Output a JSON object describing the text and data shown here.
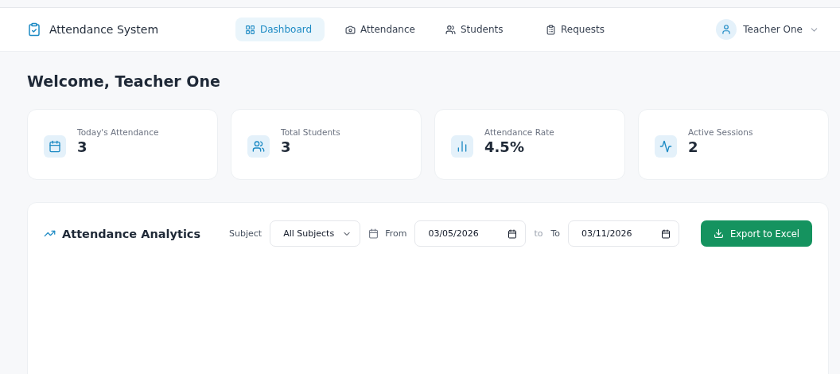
{
  "app": {
    "title": "Attendance System"
  },
  "nav": [
    {
      "label": "Dashboard",
      "kind": "dashboard",
      "selected": true
    },
    {
      "label": "Attendance",
      "kind": "camera",
      "selected": false
    },
    {
      "label": "Students",
      "kind": "users",
      "selected": false
    },
    {
      "label": "Requests",
      "kind": "clipboard",
      "selected": false
    }
  ],
  "user": {
    "name": "Teacher One"
  },
  "welcome": "Welcome, Teacher One",
  "stats": [
    {
      "label": "Today's Attendance",
      "value": "3",
      "kind": "calendar"
    },
    {
      "label": "Total Students",
      "value": "3",
      "kind": "users"
    },
    {
      "label": "Attendance Rate",
      "value": "4.5%",
      "kind": "chart"
    },
    {
      "label": "Active Sessions",
      "value": "2",
      "kind": "activity"
    }
  ],
  "analytics": {
    "title": "Attendance Analytics",
    "subject_label": "Subject",
    "subject_value": "All Subjects",
    "from_label": "From",
    "from_value": "03/05/2026",
    "separator": "to",
    "to_label": "To",
    "to_value": "03/11/2026",
    "export_button": "Export to Excel"
  }
}
